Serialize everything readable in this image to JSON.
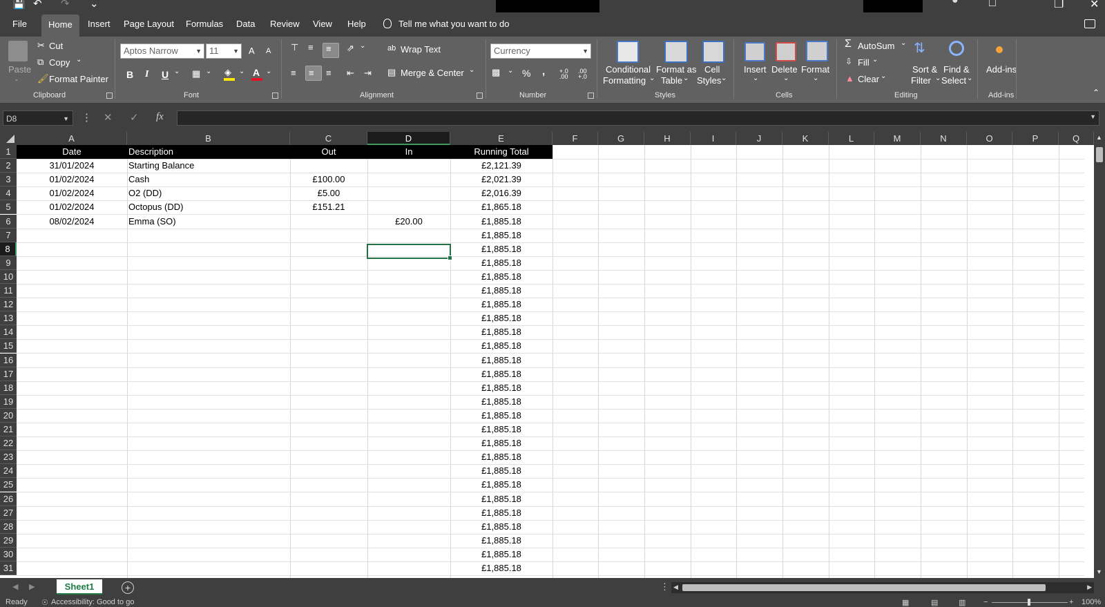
{
  "menu": {
    "tabs": [
      "File",
      "Home",
      "Insert",
      "Page Layout",
      "Formulas",
      "Data",
      "Review",
      "View",
      "Help"
    ],
    "active": "Home",
    "tell_me": "Tell me what you want to do"
  },
  "ribbon": {
    "clipboard": {
      "paste": "Paste",
      "cut": "Cut",
      "copy": "Copy",
      "format_painter": "Format Painter",
      "label": "Clipboard"
    },
    "font": {
      "name": "Aptos Narrow",
      "size": "11",
      "grow": "A",
      "shrink": "A",
      "bold": "B",
      "italic": "I",
      "underline": "U",
      "color_glyph": "A",
      "label": "Font"
    },
    "alignment": {
      "wrap_text": "Wrap Text",
      "merge_center": "Merge & Center",
      "label": "Alignment"
    },
    "number": {
      "format": "Currency",
      "percent": "%",
      "comma": ",",
      "inc_decimal": "+.0 .00",
      "dec_decimal": ".00 +.0",
      "label": "Number"
    },
    "styles": {
      "conditional": [
        "Conditional",
        "Formatting"
      ],
      "format_table": [
        "Format as",
        "Table"
      ],
      "cell_styles": [
        "Cell",
        "Styles"
      ],
      "label": "Styles"
    },
    "cells": {
      "insert": "Insert",
      "delete": "Delete",
      "format": "Format",
      "label": "Cells"
    },
    "editing": {
      "autosum": "AutoSum",
      "fill": "Fill",
      "clear": "Clear",
      "sort": [
        "Sort &",
        "Filter"
      ],
      "find": [
        "Find &",
        "Select"
      ],
      "label": "Editing"
    },
    "addins": {
      "name": "Add-ins",
      "label": "Add-ins"
    }
  },
  "formula_bar": {
    "name_box": "D8",
    "fx": "fx",
    "value": ""
  },
  "sheet": {
    "columns": [
      "A",
      "B",
      "C",
      "D",
      "E",
      "F",
      "G",
      "H",
      "I",
      "J",
      "K",
      "L",
      "M",
      "N",
      "O",
      "P",
      "Q"
    ],
    "selected_column": "D",
    "selected_row": 8,
    "row_numbers": [
      1,
      2,
      3,
      4,
      5,
      6,
      7,
      8,
      9,
      10,
      11,
      12,
      13,
      14,
      15,
      16,
      17,
      18,
      19,
      20,
      21,
      22,
      23,
      24,
      25,
      26,
      27,
      28,
      29,
      30,
      31
    ],
    "headers": {
      "date": "Date",
      "description": "Description",
      "out": "Out",
      "in": "In",
      "running_total": "Running Total"
    },
    "rows": [
      {
        "date": "31/01/2024",
        "description": "Starting Balance",
        "out": "",
        "in": "",
        "total": "£2,121.39"
      },
      {
        "date": "01/02/2024",
        "description": "Cash",
        "out": "£100.00",
        "in": "",
        "total": "£2,021.39"
      },
      {
        "date": "01/02/2024",
        "description": "O2  (DD)",
        "out": "£5.00",
        "in": "",
        "total": "£2,016.39"
      },
      {
        "date": "01/02/2024",
        "description": "Octopus  (DD)",
        "out": "£151.21",
        "in": "",
        "total": "£1,865.18"
      },
      {
        "date": "08/02/2024",
        "description": "Emma (SO)",
        "out": "",
        "in": "£20.00",
        "total": "£1,885.18"
      },
      {
        "date": "",
        "description": "",
        "out": "",
        "in": "",
        "total": "£1,885.18"
      },
      {
        "date": "",
        "description": "",
        "out": "",
        "in": "",
        "total": "£1,885.18"
      },
      {
        "date": "",
        "description": "",
        "out": "",
        "in": "",
        "total": "£1,885.18"
      },
      {
        "date": "",
        "description": "",
        "out": "",
        "in": "",
        "total": "£1,885.18"
      },
      {
        "date": "",
        "description": "",
        "out": "",
        "in": "",
        "total": "£1,885.18"
      },
      {
        "date": "",
        "description": "",
        "out": "",
        "in": "",
        "total": "£1,885.18"
      },
      {
        "date": "",
        "description": "",
        "out": "",
        "in": "",
        "total": "£1,885.18"
      },
      {
        "date": "",
        "description": "",
        "out": "",
        "in": "",
        "total": "£1,885.18"
      },
      {
        "date": "",
        "description": "",
        "out": "",
        "in": "",
        "total": "£1,885.18"
      },
      {
        "date": "",
        "description": "",
        "out": "",
        "in": "",
        "total": "£1,885.18"
      },
      {
        "date": "",
        "description": "",
        "out": "",
        "in": "",
        "total": "£1,885.18"
      },
      {
        "date": "",
        "description": "",
        "out": "",
        "in": "",
        "total": "£1,885.18"
      },
      {
        "date": "",
        "description": "",
        "out": "",
        "in": "",
        "total": "£1,885.18"
      },
      {
        "date": "",
        "description": "",
        "out": "",
        "in": "",
        "total": "£1,885.18"
      },
      {
        "date": "",
        "description": "",
        "out": "",
        "in": "",
        "total": "£1,885.18"
      },
      {
        "date": "",
        "description": "",
        "out": "",
        "in": "",
        "total": "£1,885.18"
      },
      {
        "date": "",
        "description": "",
        "out": "",
        "in": "",
        "total": "£1,885.18"
      },
      {
        "date": "",
        "description": "",
        "out": "",
        "in": "",
        "total": "£1,885.18"
      },
      {
        "date": "",
        "description": "",
        "out": "",
        "in": "",
        "total": "£1,885.18"
      },
      {
        "date": "",
        "description": "",
        "out": "",
        "in": "",
        "total": "£1,885.18"
      },
      {
        "date": "",
        "description": "",
        "out": "",
        "in": "",
        "total": "£1,885.18"
      },
      {
        "date": "",
        "description": "",
        "out": "",
        "in": "",
        "total": "£1,885.18"
      },
      {
        "date": "",
        "description": "",
        "out": "",
        "in": "",
        "total": "£1,885.18"
      },
      {
        "date": "",
        "description": "",
        "out": "",
        "in": "",
        "total": "£1,885.18"
      },
      {
        "date": "",
        "description": "",
        "out": "",
        "in": "",
        "total": "£1,885.18"
      }
    ]
  },
  "sheet_tabs": {
    "active": "Sheet1",
    "add": "+"
  },
  "status": {
    "ready": "Ready",
    "accessibility": "Accessibility: Good to go",
    "zoom": "100%"
  },
  "colors": {
    "accent": "#217346",
    "chrome": "#3f3f3f",
    "ribbon": "#616161",
    "header_fill": "#000000"
  }
}
